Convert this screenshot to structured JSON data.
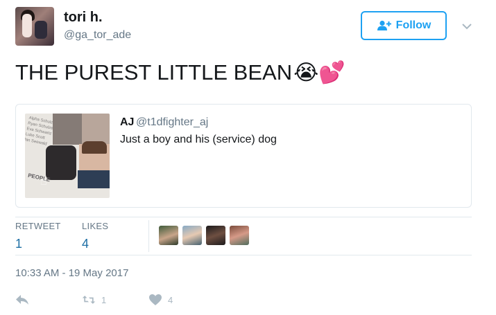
{
  "user": {
    "display_name": "tori h.",
    "handle": "@ga_tor_ade",
    "follow_label": "Follow"
  },
  "tweet": {
    "text": "THE PUREST LITTLE BEAN",
    "emoji": "😭💕",
    "timestamp": "10:33 AM - 19 May 2017"
  },
  "quote": {
    "name": "AJ",
    "handle": "@t1dfighter_aj",
    "text": "Just a boy and his (service) dog",
    "image_caption": "PEOPLE"
  },
  "stats": {
    "retweet_label": "RETWEET",
    "retweet_count": "1",
    "likes_label": "LIKES",
    "likes_count": "4"
  },
  "actions": {
    "retweet_count": "1",
    "like_count": "4"
  },
  "colors": {
    "accent": "#1da1f2",
    "muted": "#657786",
    "count": "#1c6ea4"
  }
}
